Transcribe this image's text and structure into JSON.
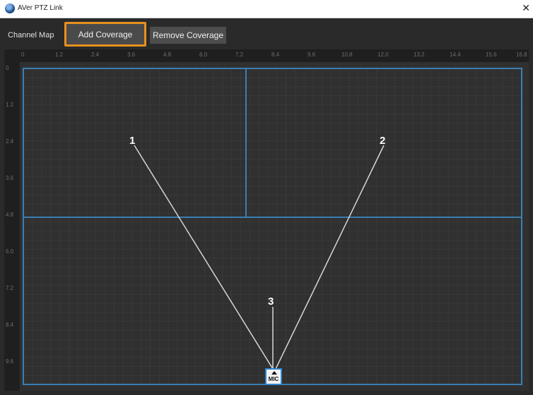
{
  "window": {
    "title": "AVer PTZ Link",
    "close_icon": "close-icon"
  },
  "toolbar": {
    "channel_map_label": "Channel Map",
    "add_label": "Add Coverage",
    "remove_label": "Remove Coverage"
  },
  "ruler": {
    "top": [
      "0",
      "1.2",
      "2.4",
      "3.6",
      "4.8",
      "6.0",
      "7.2",
      "8.4",
      "9.6",
      "10.8",
      "12.0",
      "13.2",
      "14.4",
      "15.6",
      "16.8"
    ],
    "left": [
      "0",
      "1.2",
      "2.4",
      "3.6",
      "4.8",
      "6.0",
      "7.2",
      "8.4",
      "9.6"
    ]
  },
  "map": {
    "mic_label": "MIC",
    "pointers": [
      {
        "label": "1"
      },
      {
        "label": "2"
      },
      {
        "label": "3"
      }
    ]
  },
  "colors": {
    "accent": "#e8911e",
    "zone_border": "#3a7fb3",
    "mic_border": "#2f86d1"
  }
}
